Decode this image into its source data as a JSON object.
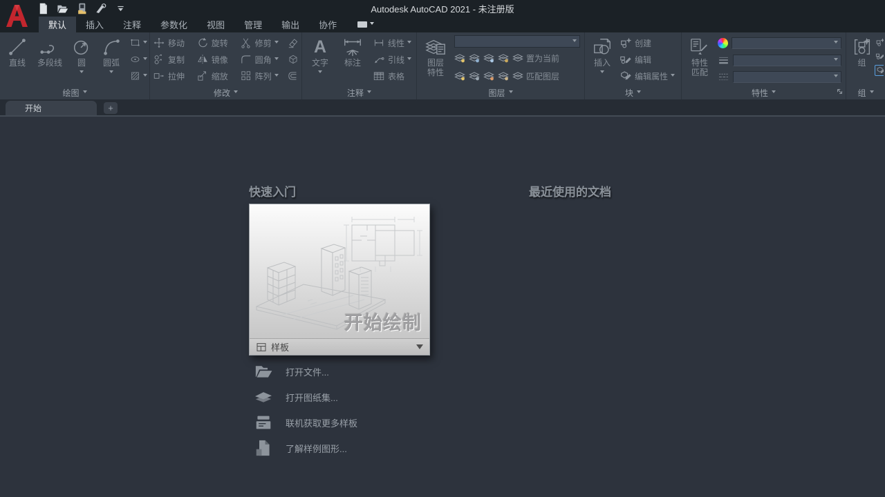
{
  "titlebar": {
    "title": "Autodesk AutoCAD 2021 - 未注册版"
  },
  "quick_access": {
    "icons": [
      "new-file-icon",
      "open-folder-icon",
      "save-icon",
      "plot-icon",
      "customize-dropdown-icon"
    ]
  },
  "ribbon": {
    "tabs": [
      "默认",
      "插入",
      "注释",
      "参数化",
      "视图",
      "管理",
      "输出",
      "协作"
    ],
    "active_tab": "默认",
    "panels": {
      "draw": {
        "label": "绘图",
        "line": "直线",
        "polyline": "多段线",
        "circle": "圆",
        "arc": "圆弧"
      },
      "modify": {
        "label": "修改",
        "move": "移动",
        "rotate": "旋转",
        "trim": "修剪",
        "copy": "复制",
        "mirror": "镜像",
        "fillet": "圆角",
        "stretch": "拉伸",
        "scale": "缩放",
        "array": "阵列"
      },
      "annotation": {
        "label": "注释",
        "text": "文字",
        "dimension": "标注",
        "linear": "线性",
        "leader": "引线",
        "table": "表格"
      },
      "layers": {
        "label": "图层",
        "layer_properties": "图层特性",
        "set_current": "置为当前",
        "match_layer": "匹配图层"
      },
      "block": {
        "label": "块",
        "insert": "插入",
        "create": "创建",
        "edit": "编辑",
        "edit_attributes": "编辑属性"
      },
      "properties": {
        "label": "特性",
        "match_properties": "特性匹配"
      },
      "groups": {
        "label": "组",
        "group": "组"
      }
    }
  },
  "file_tabs": {
    "start_tab": "开始",
    "new_tab_label": "+"
  },
  "start_page": {
    "quick_start_heading": "快速入门",
    "recent_docs_heading": "最近使用的文档",
    "card": {
      "start_drawing": "开始绘制",
      "template": "样板"
    },
    "links": [
      {
        "icon": "open-file-icon",
        "label": "打开文件..."
      },
      {
        "icon": "sheet-set-icon",
        "label": "打开图纸集..."
      },
      {
        "icon": "online-templates-icon",
        "label": "联机获取更多样板"
      },
      {
        "icon": "sample-drawings-icon",
        "label": "了解样例图形..."
      }
    ]
  },
  "colors": {
    "logo_red": "#c2262e",
    "titlebar_bg": "#1b2126",
    "ribbon_bg": "#353d47",
    "canvas_bg": "#2d333d",
    "template_bar_bg": "#c6c6c6",
    "highlight_blue": "#5aa0e0",
    "save_folder_yellow": "#e4bf6a"
  }
}
